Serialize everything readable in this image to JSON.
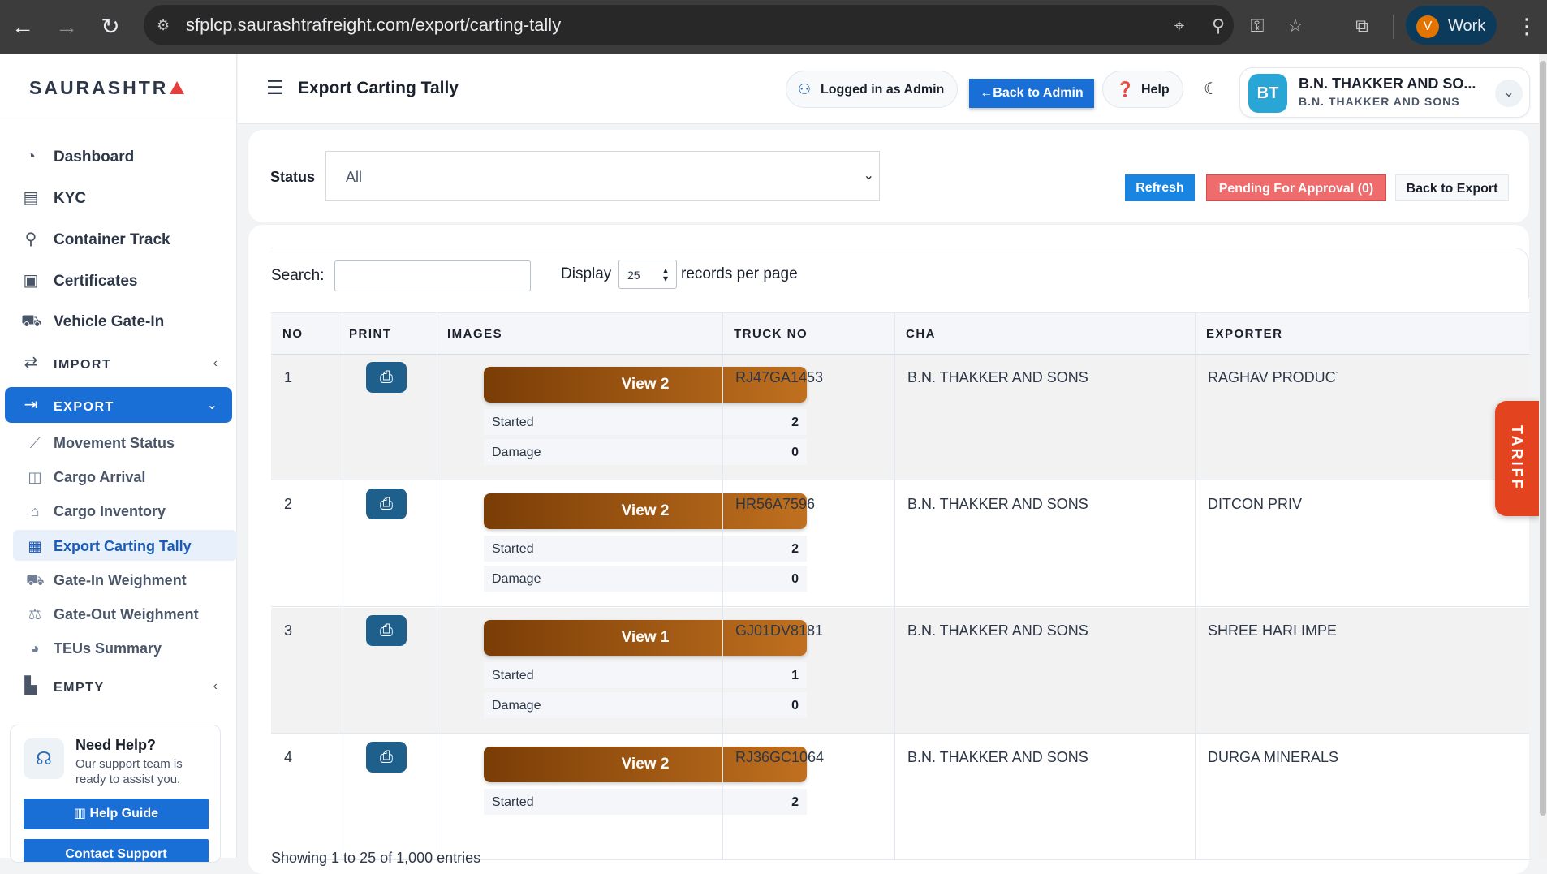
{
  "browser": {
    "url": "sfplcp.saurashtrafreight.com/export/carting-tally",
    "profile_initial": "V",
    "profile_label": "Work"
  },
  "sidebar": {
    "logo": "SAURASHTR",
    "items": [
      {
        "label": "Dashboard",
        "icon": "dashboard-icon"
      },
      {
        "label": "KYC",
        "icon": "kyc-icon"
      },
      {
        "label": "Container Track",
        "icon": "route-icon"
      },
      {
        "label": "Certificates",
        "icon": "certificate-icon"
      },
      {
        "label": "Vehicle Gate-In",
        "icon": "truck-icon"
      }
    ],
    "import_label": "IMPORT",
    "export_label": "EXPORT",
    "empty_label": "EMPTY",
    "export_sub": [
      {
        "label": "Movement Status"
      },
      {
        "label": "Cargo Arrival"
      },
      {
        "label": "Cargo Inventory"
      },
      {
        "label": "Export Carting Tally"
      },
      {
        "label": "Gate-In Weighment"
      },
      {
        "label": "Gate-Out Weighment"
      },
      {
        "label": "TEUs Summary"
      }
    ],
    "help": {
      "title": "Need Help?",
      "subtitle": "Our support team is ready to assist you.",
      "guide_button": "Help Guide",
      "contact_button": "Contact Support"
    }
  },
  "header": {
    "title": "Export Carting Tally",
    "logged_in": "Logged in as Admin",
    "back_to_admin": "Back to Admin",
    "help": "Help",
    "user_initials": "BT",
    "user_name": "B.N. THAKKER AND SO...",
    "user_sub": "B.N. THAKKER AND SONS"
  },
  "filter": {
    "status_label": "Status",
    "status_value": "All",
    "refresh": "Refresh",
    "pending": "Pending For Approval (0)",
    "back_to_export": "Back to Export"
  },
  "table": {
    "search_label": "Search:",
    "display_label": "Display",
    "page_size": "25",
    "records_label": "records per page",
    "columns": [
      "NO",
      "PRINT",
      "IMAGES",
      "TRUCK NO",
      "CHA",
      "EXPORTER"
    ],
    "started_label": "Started",
    "damage_label": "Damage",
    "rows": [
      {
        "no": "1",
        "view": "View 2",
        "started": "2",
        "damage": "0",
        "truck": "RJ47GA1453",
        "cha": "B.N. THAKKER AND SONS",
        "exporter": "RAGHAV PRODUCTI"
      },
      {
        "no": "2",
        "view": "View 2",
        "started": "2",
        "damage": "0",
        "truck": "HR56A7596",
        "cha": "B.N. THAKKER AND SONS",
        "exporter": "DITCON PRIV"
      },
      {
        "no": "3",
        "view": "View 1",
        "started": "1",
        "damage": "0",
        "truck": "GJ01DV8181",
        "cha": "B.N. THAKKER AND SONS",
        "exporter": "SHREE HARI IMPEX"
      },
      {
        "no": "4",
        "view": "View 2",
        "started": "2",
        "damage": "",
        "truck": "RJ36GC1064",
        "cha": "B.N. THAKKER AND SONS",
        "exporter": "DURGA MINERALS"
      }
    ],
    "footer": "Showing 1 to 25 of 1,000 entries"
  },
  "tariff_label": "TARIFF",
  "colors": {
    "primary": "#1a6fd6",
    "danger": "#f06b6b",
    "view_gradient_start": "#7a3d06",
    "view_gradient_end": "#c0701f",
    "tariff": "#e4431f"
  }
}
